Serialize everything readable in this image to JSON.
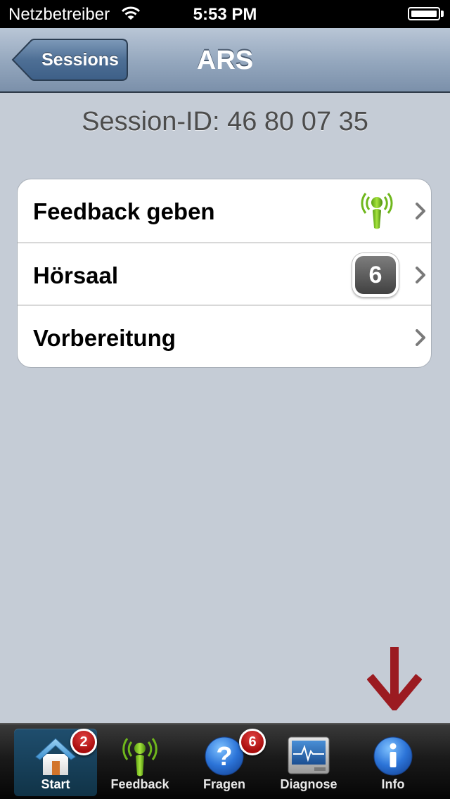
{
  "status_bar": {
    "carrier": "Netzbetreiber",
    "time": "5:53 PM"
  },
  "nav": {
    "back_label": "Sessions",
    "title": "ARS"
  },
  "session_id_text": "Session-ID: 46 80 07 35",
  "rows": [
    {
      "label": "Feedback geben",
      "accessory": "feedback-signal-icon"
    },
    {
      "label": "Hörsaal",
      "count": "6"
    },
    {
      "label": "Vorbereitung"
    }
  ],
  "tabs": [
    {
      "label": "Start",
      "badge": "2",
      "icon": "home-icon",
      "selected": true
    },
    {
      "label": "Feedback",
      "icon": "feedback-signal-icon"
    },
    {
      "label": "Fragen",
      "badge": "6",
      "icon": "question-icon"
    },
    {
      "label": "Diagnose",
      "icon": "diagnose-monitor-icon"
    },
    {
      "label": "Info",
      "icon": "info-icon"
    }
  ],
  "colors": {
    "background": "#c5ccd6",
    "badge_red": "#c41a1a",
    "annotation_arrow": "#9b1b21",
    "feedback_green": "#7bc41f"
  }
}
